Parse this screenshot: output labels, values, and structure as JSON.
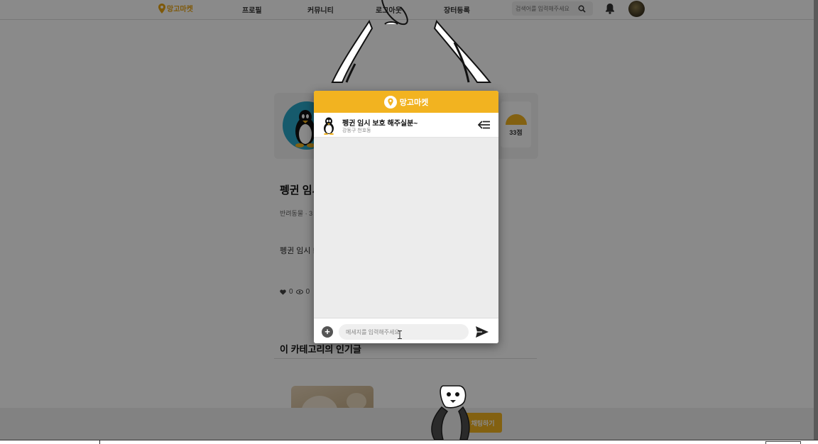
{
  "navbar": {
    "logo_text": "망고마켓",
    "items": [
      "프로필",
      "커뮤니티",
      "로그아웃",
      "장터등록"
    ],
    "search_placeholder": "검색어를 입력해주세요"
  },
  "profile": {
    "rating": "33점"
  },
  "post": {
    "title": "펭귄 임시",
    "meta": "반려동물 · 3",
    "body": "펭귄 임시 !",
    "likes": "0",
    "views": "0"
  },
  "popular": {
    "section_title": "이 카테고리의 인기글"
  },
  "cta": {
    "chat_button": "채팅하기"
  },
  "chat": {
    "header_title": "망고마켓",
    "room_title": "펭귄 임시 보호 해주실분~",
    "room_location": "강동구 천호동",
    "input_placeholder": "메세지를 입력해주세요"
  },
  "colors": {
    "brand": "#f2b320",
    "overlay": "rgba(0,0,0,0.46)"
  }
}
